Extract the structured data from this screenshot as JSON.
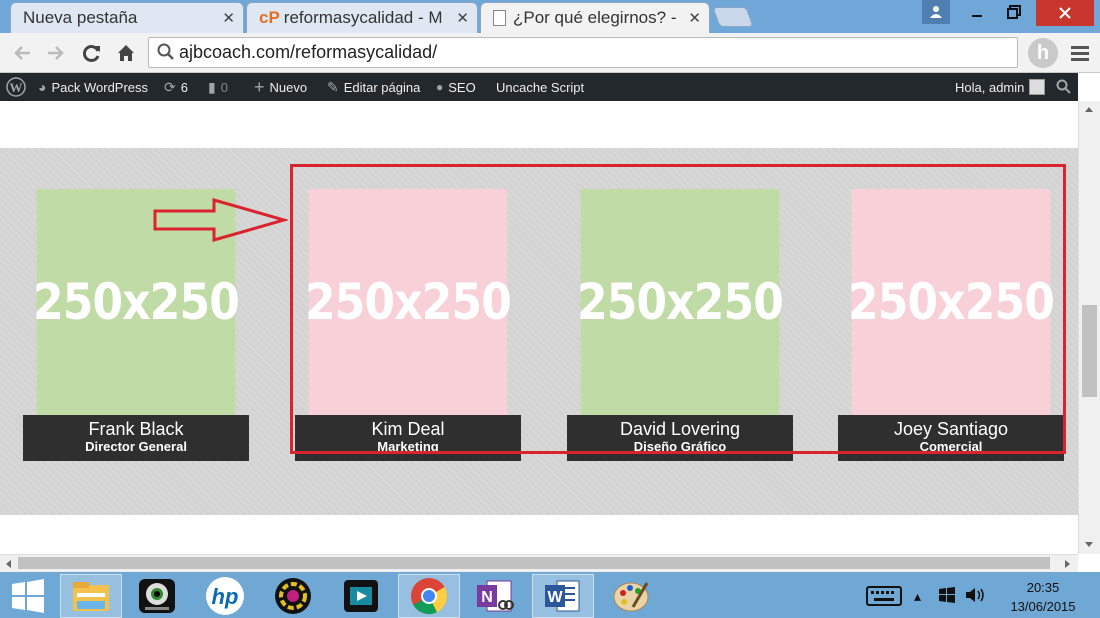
{
  "browser": {
    "tabs": [
      {
        "label": "Nueva pestaña",
        "active": false
      },
      {
        "label": "reformasycalidad - M",
        "prefix": "cP",
        "active": false
      },
      {
        "label": "¿Por qué elegirnos? -",
        "active": true
      }
    ],
    "url": "ajbcoach.com/reformasycalidad/",
    "profile_initial": "h"
  },
  "adminbar": {
    "pack": "Pack WordPress",
    "updates": "6",
    "comments": "0",
    "new": "Nuevo",
    "edit": "Editar página",
    "seo": "SEO",
    "uncache": "Uncache Script",
    "greeting": "Hola, admin"
  },
  "team": [
    {
      "image_text": "250x250",
      "name": "Frank Black",
      "role": "Director General",
      "color": "#c1dba6"
    },
    {
      "image_text": "250x250",
      "name": "Kim Deal",
      "role": "Marketing",
      "color": "#f7d0d8"
    },
    {
      "image_text": "250x250",
      "name": "David Lovering",
      "role": "Diseño Gráfico",
      "color": "#c1dba6"
    },
    {
      "image_text": "250x250",
      "name": "Joey Santiago",
      "role": "Comercial",
      "color": "#f7d0d8"
    }
  ],
  "annotation": {
    "color": "#d9232e"
  },
  "taskbar": {
    "apps": [
      "start-icon",
      "file-explorer-icon",
      "webcam-icon",
      "hp-icon",
      "media-icon",
      "video-editor-icon",
      "chrome-icon",
      "onenote-icon",
      "word-icon",
      "paint-icon"
    ],
    "time": "20:35",
    "date": "13/06/2015"
  }
}
